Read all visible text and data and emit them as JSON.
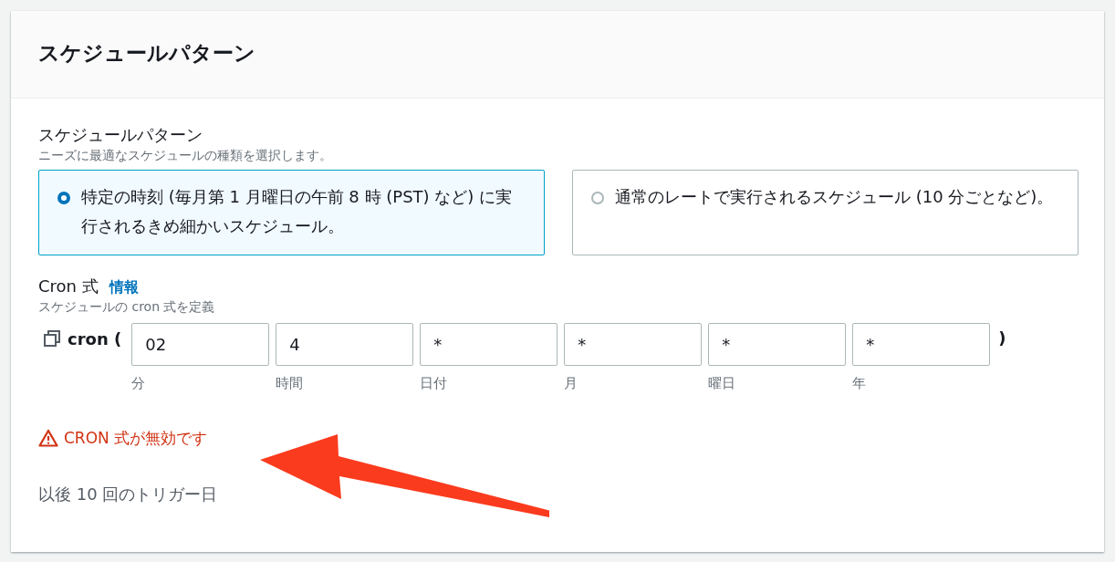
{
  "header": {
    "title": "スケジュールパターン"
  },
  "schedule_pattern": {
    "label": "スケジュールパターン",
    "description": "ニーズに最適なスケジュールの種類を選択します。",
    "options": [
      {
        "text": "特定の時刻 (毎月第 1 月曜日の午前 8 時 (PST) など) に実行されるきめ細かいスケジュール。",
        "selected": true
      },
      {
        "text": "通常のレートで実行されるスケジュール (10 分ごとなど)。",
        "selected": false
      }
    ]
  },
  "cron": {
    "label": "Cron 式",
    "info_link": "情報",
    "description": "スケジュールの cron 式を定義",
    "prefix": "cron (",
    "suffix": ")",
    "fields": [
      {
        "value": "02",
        "label": "分"
      },
      {
        "value": "4",
        "label": "時間"
      },
      {
        "value": "*",
        "label": "日付"
      },
      {
        "value": "*",
        "label": "月"
      },
      {
        "value": "*",
        "label": "曜日"
      },
      {
        "value": "*",
        "label": "年"
      }
    ]
  },
  "error": "CRON 式が無効です",
  "next_triggers_label": "以後 10 回のトリガー日"
}
